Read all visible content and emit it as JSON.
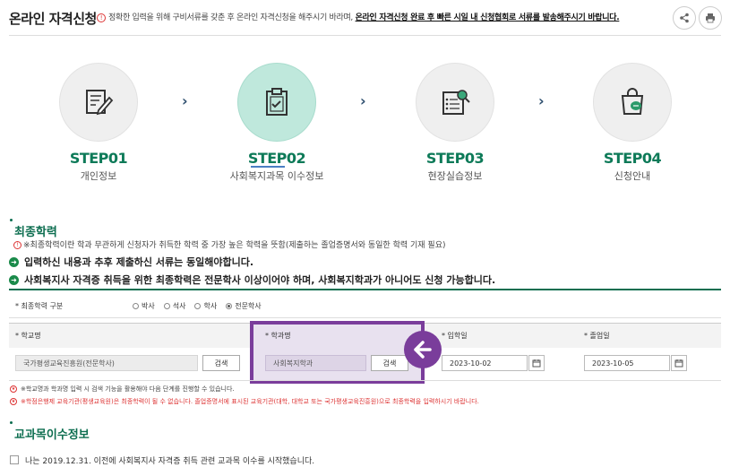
{
  "header": {
    "title": "온라인 자격신청",
    "notice_prefix": "정확한 입력을 위해 구비서류를 갖춘 후 온라인 자격신청을 해주시기 바라며,",
    "notice_bold": "온라인 자격신청 완료 후 빠른 시일 내 신청협회로 서류를 발송해주시기 바랍니다."
  },
  "steps": [
    {
      "step_word": "STEP",
      "number": "01",
      "label": "개인정보",
      "icon": "pencil-document-icon",
      "active": false
    },
    {
      "step_word": "STEP",
      "number": "02",
      "label": "사회복지과목 이수정보",
      "icon": "clipboard-check-icon",
      "active": true
    },
    {
      "step_word": "STEP",
      "number": "03",
      "label": "현장실습정보",
      "icon": "search-list-icon",
      "active": false
    },
    {
      "step_word": "STEP",
      "number": "04",
      "label": "신청안내",
      "icon": "shopping-bag-chat-icon",
      "active": false
    }
  ],
  "education": {
    "title": "최종학력",
    "info": "※최종학력이란 학과 무관하게 신청자가 취득한 학력 중 가장 높은 학력을 뜻함(제출하는 졸업증명서와 동일한 학력 기재 필요)",
    "line1": "입력하신 내용과 추후 제출하신 서류는 동일해야합니다.",
    "line2": "사회복지사 자격증 취득을 위한 최종학력은 전문학사 이상이어야 하며, 사회복지학과가 아니어도 신청 가능합니다.",
    "degree_label": "* 최종학력 구분",
    "degree_options": [
      "박사",
      "석사",
      "학사",
      "전문학사"
    ],
    "degree_selected": "전문학사",
    "school_label": "* 학교명",
    "school_value": "국가평생교육진흥원(전문학사)",
    "search_label": "검색",
    "major_label": "* 학과명",
    "major_value": "사회복지학과",
    "major_search_label": "검색",
    "admission_label": "* 입학일",
    "admission_value": "2023-10-02",
    "graduation_label": "* 졸업일",
    "graduation_value": "2023-10-05",
    "warn1": "※학교명과 학과명 입력 시 검색 기능을 활용해야 다음 단계를 진행할 수 있습니다.",
    "warn2": "※학점은행제 교육기관(평생교육원)은 최종학력이 될 수 없습니다. 졸업증명서에 표시된 교육기관(대학, 대학교 또는 국가평생교육진흥원)으로 최종학력을 입력하시기 바랍니다."
  },
  "courses": {
    "title": "교과목이수정보",
    "checkbox_label": "나는 2019.12.31. 이전에 사회복지사 자격증 취득 관련 교과목 이수를 시작했습니다."
  },
  "colors": {
    "accent": "#0d6e50",
    "highlight": "#7a3d9b",
    "active_circle": "#bfe8dc"
  }
}
